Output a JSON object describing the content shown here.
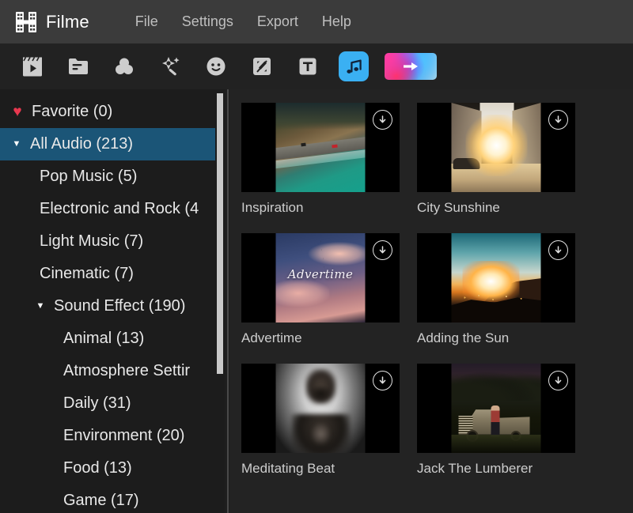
{
  "app": {
    "brand": "Filme",
    "logo_icon": "film-strip-icon"
  },
  "menu": {
    "items": [
      {
        "label": "File"
      },
      {
        "label": "Settings"
      },
      {
        "label": "Export"
      },
      {
        "label": "Help"
      }
    ]
  },
  "toolbar": {
    "items": [
      {
        "icon": "media-clapperboard-icon",
        "name": "media",
        "active": false
      },
      {
        "icon": "folder-icon",
        "name": "my-media",
        "active": false
      },
      {
        "icon": "filters-circles-icon",
        "name": "filters",
        "active": false
      },
      {
        "icon": "effects-sparkle-icon",
        "name": "effects",
        "active": false
      },
      {
        "icon": "sticker-smiley-icon",
        "name": "stickers",
        "active": false
      },
      {
        "icon": "split-screen-icon",
        "name": "split-screen",
        "active": false
      },
      {
        "icon": "text-t-icon",
        "name": "text",
        "active": false
      },
      {
        "icon": "music-note-icon",
        "name": "audio",
        "active": true
      },
      {
        "icon": "transition-arrow-icon",
        "name": "transitions",
        "active": false
      }
    ],
    "active_accent": "#3ab0f3"
  },
  "sidebar": {
    "selected_bg": "#1b5577",
    "items": [
      {
        "label": "Favorite (0)",
        "level": 0,
        "icon": "heart-icon",
        "caret": "",
        "selected": false
      },
      {
        "label": "All Audio (213)",
        "level": 0,
        "icon": "",
        "caret": "▼",
        "selected": true
      },
      {
        "label": "Pop Music (5)",
        "level": 1,
        "icon": "",
        "caret": "",
        "selected": false
      },
      {
        "label": "Electronic and Rock (4",
        "level": 1,
        "icon": "",
        "caret": "",
        "selected": false
      },
      {
        "label": "Light Music (7)",
        "level": 1,
        "icon": "",
        "caret": "",
        "selected": false
      },
      {
        "label": "Cinematic (7)",
        "level": 1,
        "icon": "",
        "caret": "",
        "selected": false
      },
      {
        "label": "Sound Effect (190)",
        "level": 1,
        "icon": "",
        "caret": "▼",
        "selected": false
      },
      {
        "label": "Animal (13)",
        "level": 2,
        "icon": "",
        "caret": "",
        "selected": false
      },
      {
        "label": "Atmosphere Settir",
        "level": 2,
        "icon": "",
        "caret": "",
        "selected": false
      },
      {
        "label": "Daily (31)",
        "level": 2,
        "icon": "",
        "caret": "",
        "selected": false
      },
      {
        "label": "Environment (20)",
        "level": 2,
        "icon": "",
        "caret": "",
        "selected": false
      },
      {
        "label": "Food (13)",
        "level": 2,
        "icon": "",
        "caret": "",
        "selected": false
      },
      {
        "label": "Game (17)",
        "level": 2,
        "icon": "",
        "caret": "",
        "selected": false
      }
    ]
  },
  "content": {
    "download_icon": "circle-arrow-down-icon",
    "cards": [
      {
        "title": "Inspiration",
        "art": "art-inspiration",
        "overlay_text": ""
      },
      {
        "title": "City Sunshine",
        "art": "art-city",
        "overlay_text": ""
      },
      {
        "title": "Advertime",
        "art": "art-advert",
        "overlay_text": "Advertime"
      },
      {
        "title": "Adding the Sun",
        "art": "art-sun",
        "overlay_text": ""
      },
      {
        "title": "Meditating Beat",
        "art": "art-medit",
        "overlay_text": ""
      },
      {
        "title": "Jack The Lumberer",
        "art": "art-jack",
        "overlay_text": ""
      }
    ]
  }
}
